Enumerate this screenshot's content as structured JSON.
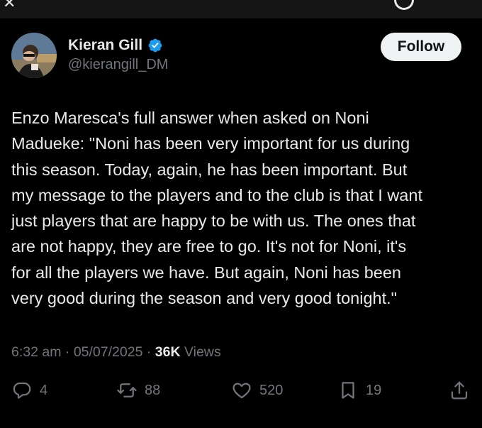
{
  "author": {
    "display_name": "Kieran Gill",
    "handle": "@kierangill_DM",
    "verified": true,
    "verified_color": "#1d9bf0"
  },
  "follow_label": "Follow",
  "tweet": {
    "text": "Enzo Maresca's full answer when asked on Noni\nMadueke: \"Noni has been very important for us during\nthis season. Today, again, he has been important. But\nmy message to the players and to the club is that I want\njust players that are happy to be with us. The ones that\nare not happy, they are free to go. It's not for Noni, it's\nfor all the players we have. But again, Noni has been\nvery good during the season and very good tonight.\""
  },
  "meta": {
    "time": "6:32 am",
    "separator": "·",
    "date": "05/07/2025",
    "views_count": "36K",
    "views_label": "Views"
  },
  "actions": {
    "replies": "4",
    "reposts": "88",
    "likes": "520",
    "bookmarks": "19"
  },
  "colors": {
    "background": "#000000",
    "text": "#e7e9ea",
    "secondary": "#71767b",
    "follow_bg": "#eff3f4"
  }
}
